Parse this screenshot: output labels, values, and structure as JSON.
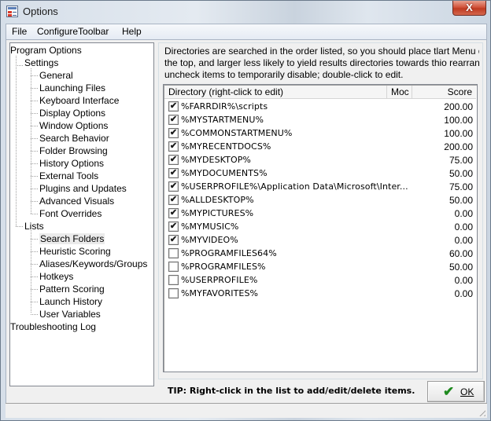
{
  "window": {
    "title": "Options",
    "icon": "options-checklist-icon",
    "close_label": "X"
  },
  "menu": {
    "items": [
      {
        "label": "File"
      },
      {
        "label": "ConfigureToolbar"
      },
      {
        "label": "Help"
      }
    ]
  },
  "tree": {
    "root": "Program Options",
    "settings": {
      "label": "Settings",
      "children": [
        "General",
        "Launching Files",
        "Keyboard Interface",
        "Display Options",
        "Window Options",
        "Search Behavior",
        "Folder Browsing",
        "History Options",
        "External Tools",
        "Plugins and Updates",
        "Advanced Visuals",
        "Font Overrides"
      ]
    },
    "lists": {
      "label": "Lists",
      "children": [
        "Search Folders",
        "Heuristic Scoring",
        "Aliases/Keywords/Groups",
        "Hotkeys",
        "Pattern Scoring",
        "Launch History",
        "User Variables"
      ]
    },
    "troubleshooting": "Troubleshooting Log",
    "selected": "Search Folders"
  },
  "panel": {
    "description": [
      "Directories are searched in the order listed, so you should place tlart Menu directory at",
      "the top, and larger less likely to yield results directories towards thio rearrange items;",
      "uncheck items to temporarily disable; double-click to edit."
    ],
    "columns": [
      {
        "label": "Directory (right-click to edit)"
      },
      {
        "label": "Moc"
      },
      {
        "label": "Score"
      }
    ],
    "rows": [
      {
        "checked": true,
        "directory": "%FARRDIR%\\scripts",
        "mod": "",
        "score": "200.00"
      },
      {
        "checked": true,
        "directory": "%MYSTARTMENU%",
        "mod": "",
        "score": "100.00"
      },
      {
        "checked": true,
        "directory": "%COMMONSTARTMENU%",
        "mod": "",
        "score": "100.00"
      },
      {
        "checked": true,
        "directory": "%MYRECENTDOCS%",
        "mod": "",
        "score": "200.00"
      },
      {
        "checked": true,
        "directory": "%MYDESKTOP%",
        "mod": "",
        "score": "75.00"
      },
      {
        "checked": true,
        "directory": "%MYDOCUMENTS%",
        "mod": "",
        "score": "50.00"
      },
      {
        "checked": true,
        "directory": "%USERPROFILE%\\Application Data\\Microsoft\\Inter...",
        "mod": "",
        "score": "75.00"
      },
      {
        "checked": true,
        "directory": "%ALLDESKTOP%",
        "mod": "",
        "score": "50.00"
      },
      {
        "checked": true,
        "directory": "%MYPICTURES%",
        "mod": "",
        "score": "0.00"
      },
      {
        "checked": true,
        "directory": "%MYMUSIC%",
        "mod": "",
        "score": "0.00"
      },
      {
        "checked": true,
        "directory": "%MYVIDEO%",
        "mod": "",
        "score": "0.00"
      },
      {
        "checked": false,
        "directory": "%PROGRAMFILES64%",
        "mod": "",
        "score": "60.00"
      },
      {
        "checked": false,
        "directory": "%PROGRAMFILES%",
        "mod": "",
        "score": "50.00"
      },
      {
        "checked": false,
        "directory": "%USERPROFILE%",
        "mod": "",
        "score": "0.00"
      },
      {
        "checked": false,
        "directory": "%MYFAVORITES%",
        "mod": "",
        "score": "0.00"
      }
    ],
    "check_glyph": "✔"
  },
  "footer": {
    "tip": "TIP: Right-click in the list to add/edit/delete items.",
    "ok_label": "OK",
    "ok_icon": "✔"
  },
  "colors": {
    "close_button": "#c84a30",
    "ok_check": "#1e8a1e",
    "selection_bg": "#ebebeb"
  }
}
